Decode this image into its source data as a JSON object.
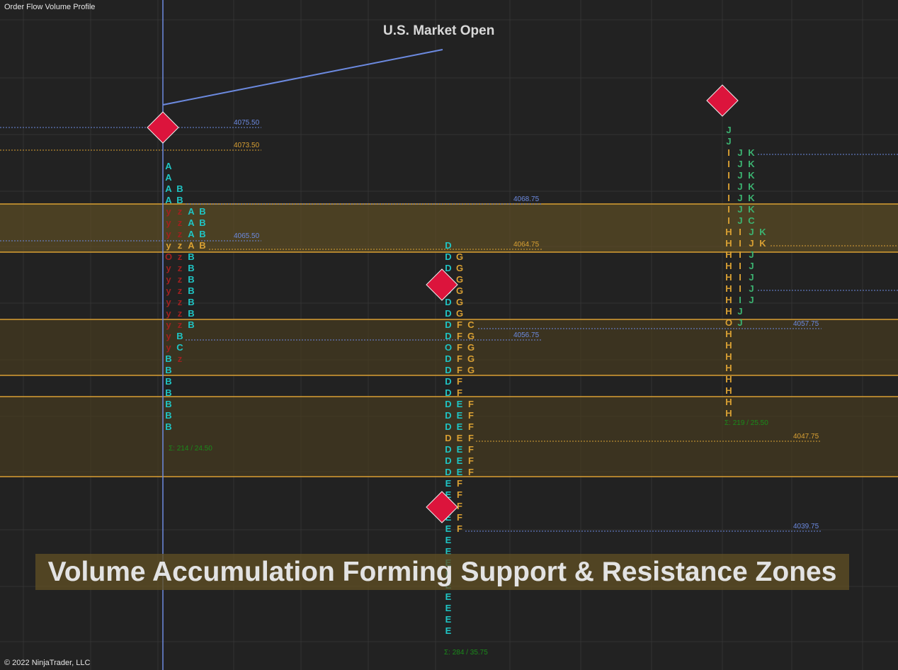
{
  "app": {
    "title": "Order Flow Volume Profile",
    "copyright": "© 2022 NinjaTrader, LLC"
  },
  "annotation": {
    "text": "U.S. Market Open"
  },
  "banner": {
    "text": "Volume Accumulation Forming Support & Resistance Zones"
  },
  "colors": {
    "background": "#222222",
    "grid": "#333333",
    "zone_fill": "rgba(95,78,36,0.68)",
    "zone_fill_dark": "rgba(70,58,32,0.7)",
    "zone_border": "#d9a033",
    "vertical_line": "#6c8ae0",
    "blue_level": "#6c8ae0",
    "orange_level": "#d9a033",
    "diamond": "#dc143c",
    "diamond_border": "#f0f0f0",
    "cyan": "#1fc4c4",
    "orange": "#d9a033",
    "green": "#3cb371",
    "darkred": "#a02020",
    "sum": "#1a8a1a"
  },
  "chart_data": {
    "type": "market-profile",
    "levels": [
      {
        "value": "4075.50",
        "color": "blue"
      },
      {
        "value": "4073.50",
        "color": "orange"
      },
      {
        "value": "4068.75",
        "color": "blue"
      },
      {
        "value": "4065.50",
        "color": "blue"
      },
      {
        "value": "4064.75",
        "color": "orange"
      },
      {
        "value": "4056.75",
        "color": "blue"
      },
      {
        "value": "4057.75",
        "color": "blue"
      },
      {
        "value": "4047.75",
        "color": "orange"
      },
      {
        "value": "4039.75",
        "color": "blue"
      }
    ],
    "profiles": [
      {
        "summary": "Σ: 214 / 24.50",
        "rows": [
          [
            [
              "A",
              "cyan"
            ]
          ],
          [
            [
              "A",
              "cyan"
            ]
          ],
          [
            [
              "A",
              "cyan"
            ],
            [
              "B",
              "cyan"
            ]
          ],
          [
            [
              "A",
              "cyan"
            ],
            [
              "B",
              "cyan"
            ]
          ],
          [
            [
              "y",
              "darkred"
            ],
            [
              "z",
              "darkred"
            ],
            [
              "A",
              "cyan"
            ],
            [
              "B",
              "cyan"
            ]
          ],
          [
            [
              "y",
              "darkred"
            ],
            [
              "z",
              "darkred"
            ],
            [
              "A",
              "cyan"
            ],
            [
              "B",
              "cyan"
            ]
          ],
          [
            [
              "y",
              "darkred"
            ],
            [
              "z",
              "darkred"
            ],
            [
              "A",
              "cyan"
            ],
            [
              "B",
              "cyan"
            ]
          ],
          [
            [
              "y",
              "orange"
            ],
            [
              "z",
              "orange"
            ],
            [
              "A",
              "orange"
            ],
            [
              "B",
              "orange"
            ]
          ],
          [
            [
              "O",
              "darkred"
            ],
            [
              "z",
              "darkred"
            ],
            [
              "B",
              "cyan"
            ]
          ],
          [
            [
              "y",
              "darkred"
            ],
            [
              "z",
              "darkred"
            ],
            [
              "B",
              "cyan"
            ]
          ],
          [
            [
              "y",
              "darkred"
            ],
            [
              "z",
              "darkred"
            ],
            [
              "B",
              "cyan"
            ]
          ],
          [
            [
              "y",
              "darkred"
            ],
            [
              "z",
              "darkred"
            ],
            [
              "B",
              "cyan"
            ]
          ],
          [
            [
              "y",
              "darkred"
            ],
            [
              "z",
              "darkred"
            ],
            [
              "B",
              "cyan"
            ]
          ],
          [
            [
              "y",
              "darkred"
            ],
            [
              "z",
              "darkred"
            ],
            [
              "B",
              "cyan"
            ]
          ],
          [
            [
              "y",
              "darkred"
            ],
            [
              "z",
              "darkred"
            ],
            [
              "B",
              "cyan"
            ]
          ],
          [
            [
              "y",
              "darkred"
            ],
            [
              "B",
              "cyan"
            ]
          ],
          [
            [
              "y",
              "darkred"
            ],
            [
              "C",
              "cyan"
            ]
          ],
          [
            [
              "B",
              "cyan"
            ],
            [
              "z",
              "darkred"
            ]
          ],
          [
            [
              "B",
              "cyan"
            ]
          ],
          [
            [
              "B",
              "cyan"
            ]
          ],
          [
            [
              "B",
              "cyan"
            ]
          ],
          [
            [
              "B",
              "cyan"
            ]
          ],
          [
            [
              "B",
              "cyan"
            ]
          ],
          [
            [
              "B",
              "cyan"
            ]
          ]
        ]
      },
      {
        "summary": "Σ: 284 / 35.75",
        "rows": [
          [
            [
              "D",
              "cyan"
            ]
          ],
          [
            [
              "D",
              "cyan"
            ],
            [
              "G",
              "orange"
            ]
          ],
          [
            [
              "D",
              "cyan"
            ],
            [
              "G",
              "orange"
            ]
          ],
          [
            [
              "D",
              "cyan"
            ],
            [
              "G",
              "orange"
            ]
          ],
          [
            [
              "D",
              "cyan"
            ],
            [
              "G",
              "orange"
            ]
          ],
          [
            [
              "D",
              "cyan"
            ],
            [
              "G",
              "orange"
            ]
          ],
          [
            [
              "D",
              "cyan"
            ],
            [
              "G",
              "orange"
            ]
          ],
          [
            [
              "D",
              "cyan"
            ],
            [
              "F",
              "orange"
            ],
            [
              "C",
              "orange"
            ]
          ],
          [
            [
              "D",
              "cyan"
            ],
            [
              "F",
              "orange"
            ],
            [
              "G",
              "orange"
            ]
          ],
          [
            [
              "O",
              "cyan"
            ],
            [
              "F",
              "orange"
            ],
            [
              "G",
              "orange"
            ]
          ],
          [
            [
              "D",
              "cyan"
            ],
            [
              "F",
              "orange"
            ],
            [
              "G",
              "orange"
            ]
          ],
          [
            [
              "D",
              "cyan"
            ],
            [
              "F",
              "orange"
            ],
            [
              "G",
              "orange"
            ]
          ],
          [
            [
              "D",
              "cyan"
            ],
            [
              "F",
              "orange"
            ]
          ],
          [
            [
              "D",
              "cyan"
            ],
            [
              "F",
              "orange"
            ]
          ],
          [
            [
              "D",
              "cyan"
            ],
            [
              "E",
              "cyan"
            ],
            [
              "F",
              "orange"
            ]
          ],
          [
            [
              "D",
              "cyan"
            ],
            [
              "E",
              "cyan"
            ],
            [
              "F",
              "orange"
            ]
          ],
          [
            [
              "D",
              "cyan"
            ],
            [
              "E",
              "cyan"
            ],
            [
              "F",
              "orange"
            ]
          ],
          [
            [
              "D",
              "orange"
            ],
            [
              "E",
              "orange"
            ],
            [
              "F",
              "orange"
            ]
          ],
          [
            [
              "D",
              "cyan"
            ],
            [
              "E",
              "cyan"
            ],
            [
              "F",
              "orange"
            ]
          ],
          [
            [
              "D",
              "cyan"
            ],
            [
              "E",
              "cyan"
            ],
            [
              "F",
              "orange"
            ]
          ],
          [
            [
              "D",
              "cyan"
            ],
            [
              "E",
              "cyan"
            ],
            [
              "F",
              "orange"
            ]
          ],
          [
            [
              "E",
              "cyan"
            ],
            [
              "F",
              "orange"
            ]
          ],
          [
            [
              "E",
              "cyan"
            ],
            [
              "F",
              "orange"
            ]
          ],
          [
            [
              "E",
              "cyan"
            ],
            [
              "F",
              "orange"
            ]
          ],
          [
            [
              "E",
              "cyan"
            ],
            [
              "F",
              "orange"
            ]
          ],
          [
            [
              "E",
              "cyan"
            ],
            [
              "F",
              "orange"
            ]
          ],
          [
            [
              "E",
              "cyan"
            ]
          ],
          [
            [
              "E",
              "cyan"
            ]
          ],
          [
            [
              "E",
              "cyan"
            ]
          ],
          [
            [
              "E",
              "cyan"
            ]
          ],
          [
            [
              "E",
              "cyan"
            ]
          ],
          [
            [
              "E",
              "cyan"
            ]
          ],
          [
            [
              "E",
              "cyan"
            ]
          ],
          [
            [
              "E",
              "cyan"
            ]
          ],
          [
            [
              "E",
              "cyan"
            ]
          ]
        ]
      },
      {
        "summary": "Σ: 219 / 25.50",
        "rows": [
          [
            [
              "J",
              "green"
            ]
          ],
          [
            [
              "J",
              "green"
            ]
          ],
          [
            [
              "I",
              "orange"
            ],
            [
              "J",
              "green"
            ],
            [
              "K",
              "green"
            ]
          ],
          [
            [
              "I",
              "orange"
            ],
            [
              "J",
              "green"
            ],
            [
              "K",
              "green"
            ]
          ],
          [
            [
              "I",
              "orange"
            ],
            [
              "J",
              "green"
            ],
            [
              "K",
              "green"
            ]
          ],
          [
            [
              "I",
              "orange"
            ],
            [
              "J",
              "green"
            ],
            [
              "K",
              "green"
            ]
          ],
          [
            [
              "I",
              "orange"
            ],
            [
              "J",
              "green"
            ],
            [
              "K",
              "green"
            ]
          ],
          [
            [
              "I",
              "orange"
            ],
            [
              "J",
              "green"
            ],
            [
              "K",
              "green"
            ]
          ],
          [
            [
              "I",
              "orange"
            ],
            [
              "J",
              "green"
            ],
            [
              "C",
              "green"
            ]
          ],
          [
            [
              "H",
              "orange"
            ],
            [
              "I",
              "orange"
            ],
            [
              "J",
              "green"
            ],
            [
              "K",
              "green"
            ]
          ],
          [
            [
              "H",
              "orange"
            ],
            [
              "I",
              "orange"
            ],
            [
              "J",
              "orange"
            ],
            [
              "K",
              "orange"
            ]
          ],
          [
            [
              "H",
              "orange"
            ],
            [
              "I",
              "orange"
            ],
            [
              "J",
              "green"
            ]
          ],
          [
            [
              "H",
              "orange"
            ],
            [
              "I",
              "orange"
            ],
            [
              "J",
              "green"
            ]
          ],
          [
            [
              "H",
              "orange"
            ],
            [
              "I",
              "orange"
            ],
            [
              "J",
              "green"
            ]
          ],
          [
            [
              "H",
              "orange"
            ],
            [
              "I",
              "orange"
            ],
            [
              "J",
              "green"
            ]
          ],
          [
            [
              "H",
              "orange"
            ],
            [
              "I",
              "green"
            ],
            [
              "J",
              "green"
            ]
          ],
          [
            [
              "H",
              "orange"
            ],
            [
              "J",
              "green"
            ]
          ],
          [
            [
              "O",
              "orange"
            ],
            [
              "J",
              "green"
            ]
          ],
          [
            [
              "H",
              "orange"
            ]
          ],
          [
            [
              "H",
              "orange"
            ]
          ],
          [
            [
              "H",
              "orange"
            ]
          ],
          [
            [
              "H",
              "orange"
            ]
          ],
          [
            [
              "H",
              "orange"
            ]
          ],
          [
            [
              "H",
              "orange"
            ]
          ],
          [
            [
              "H",
              "orange"
            ]
          ],
          [
            [
              "H",
              "orange"
            ]
          ]
        ]
      }
    ]
  }
}
